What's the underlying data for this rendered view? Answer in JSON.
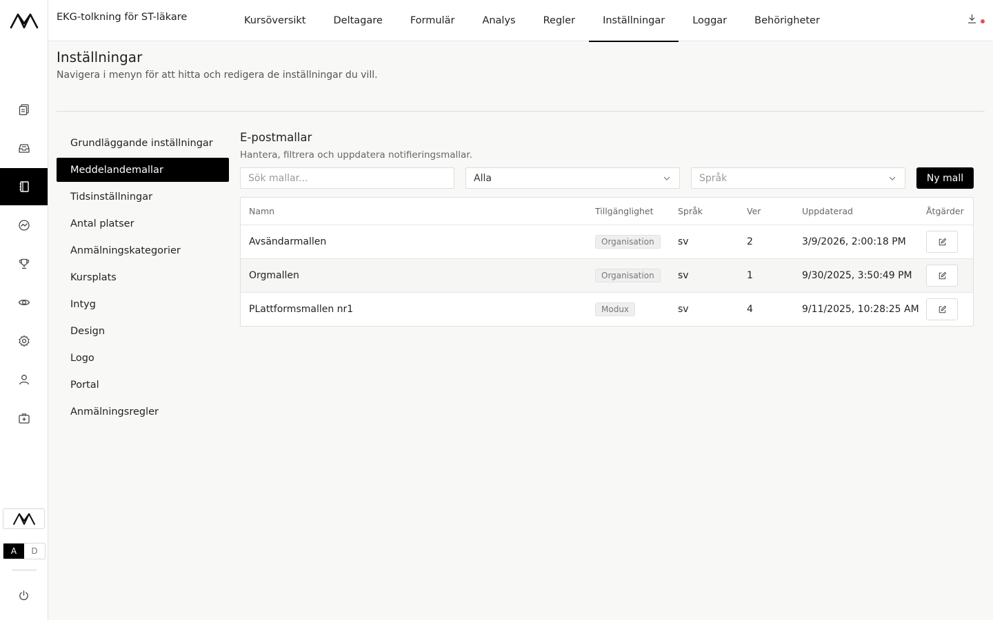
{
  "course_title": "EKG-tolkning för ST-läkare",
  "tabs": [
    {
      "label": "Kursöversikt",
      "active": false
    },
    {
      "label": "Deltagare",
      "active": false
    },
    {
      "label": "Formulär",
      "active": false
    },
    {
      "label": "Analys",
      "active": false
    },
    {
      "label": "Regler",
      "active": false
    },
    {
      "label": "Inställningar",
      "active": true
    },
    {
      "label": "Loggar",
      "active": false
    },
    {
      "label": "Behörigheter",
      "active": false
    }
  ],
  "rail": {
    "icons": [
      "copy-icon",
      "inbox-icon",
      "notebook-icon",
      "chart-icon",
      "trophy-icon",
      "eye-icon",
      "gear-icon",
      "user-icon",
      "medical-kit-icon"
    ],
    "active_icon": "notebook-icon",
    "toggle": {
      "a": "A",
      "d": "D",
      "selected": "A"
    }
  },
  "page": {
    "title": "Inställningar",
    "subtitle": "Navigera i menyn för att hitta och redigera de inställningar du vill."
  },
  "menu": [
    {
      "label": "Grundläggande inställningar",
      "active": false
    },
    {
      "label": "Meddelandemallar",
      "active": true
    },
    {
      "label": "Tidsinställningar",
      "active": false
    },
    {
      "label": "Antal platser",
      "active": false
    },
    {
      "label": "Anmälningskategorier",
      "active": false
    },
    {
      "label": "Kursplats",
      "active": false
    },
    {
      "label": "Intyg",
      "active": false
    },
    {
      "label": "Design",
      "active": false
    },
    {
      "label": "Logo",
      "active": false
    },
    {
      "label": "Portal",
      "active": false
    },
    {
      "label": "Anmälningsregler",
      "active": false
    }
  ],
  "section": {
    "title": "E-postmallar",
    "subtitle": "Hantera, filtrera och uppdatera notifieringsmallar.",
    "search_placeholder": "Sök mallar...",
    "filter_value": "Alla",
    "language_placeholder": "Språk",
    "new_button": "Ny mall"
  },
  "table": {
    "columns": [
      "Namn",
      "Tillgänglighet",
      "Språk",
      "Ver",
      "Uppdaterad",
      "Åtgärder"
    ],
    "rows": [
      {
        "name": "Avsändarmallen",
        "availability": "Organisation",
        "language": "sv",
        "version": "2",
        "updated": "3/9/2026, 2:00:18 PM"
      },
      {
        "name": "Orgmallen",
        "availability": "Organisation",
        "language": "sv",
        "version": "1",
        "updated": "9/30/2025, 3:50:49 PM"
      },
      {
        "name": "PLattformsmallen nr1",
        "availability": "Modux",
        "language": "sv",
        "version": "4",
        "updated": "9/11/2025, 10:28:25 AM"
      }
    ]
  },
  "colors": {
    "accent": "#000000",
    "notification_dot": "#e05252"
  }
}
